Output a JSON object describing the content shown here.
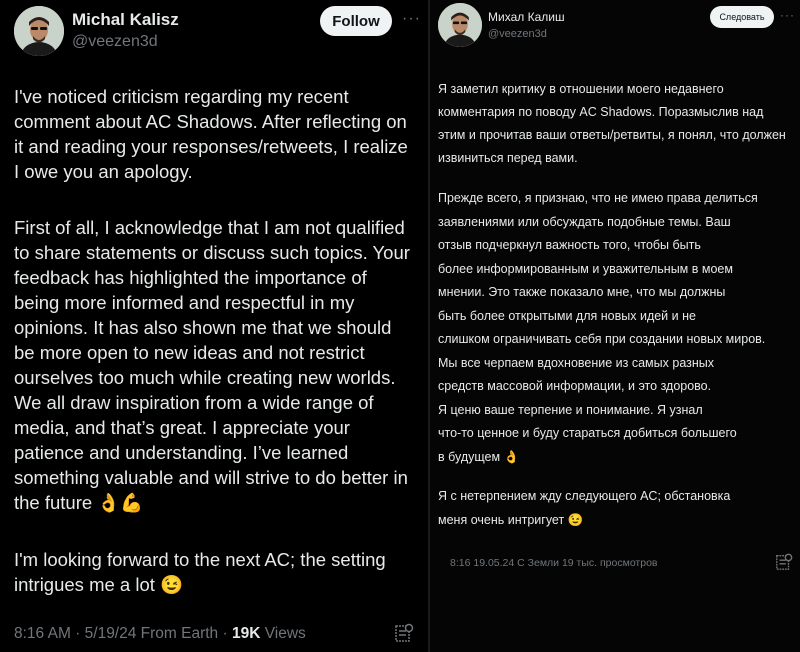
{
  "left": {
    "author_name": "Michal Kalisz",
    "handle": "@veezen3d",
    "follow_label": "Follow",
    "more_label": "···",
    "paragraph1": "I've noticed criticism regarding my recent\ncomment about AC Shadows. After reflecting on\nit and reading your responses/retweets, I realize\nI owe you an apology.",
    "paragraph2": "First of all, I acknowledge that I am not qualified\nto share statements or discuss such topics. Your\nfeedback has highlighted the importance of\nbeing more informed and respectful in my\nopinions. It has also shown me that we should\nbe more open to new ideas and not restrict\nourselves too much while creating new worlds.\nWe all draw inspiration from a wide range of\nmedia, and that’s great. I appreciate your\npatience and understanding. I’ve learned\nsomething valuable and will strive to do better in\nthe future",
    "paragraph2_emoji": "👌💪",
    "paragraph3": "I'm looking forward to the next AC; the setting\nintrigues me a lot",
    "paragraph3_emoji": "😉",
    "meta_time": "8:16 AM · 5/19/24 From Earth · ",
    "meta_views_count": "19K",
    "meta_views_label": " Views"
  },
  "right": {
    "author_name": "Михал Калиш",
    "handle": "@veezen3d",
    "follow_label": "Следовать",
    "more_label": "···",
    "paragraph1": "Я заметил критику в отношении моего недавнего\nкомментария по поводу AC Shadows. Поразмыслив над\nэтим и прочитав ваши ответы/ретвиты, я понял, что должен\nизвиниться перед вами.",
    "paragraph2": "Прежде всего, я признаю, что не имею права делиться\nзаявлениями или обсуждать подобные темы. Ваш\nотзыв подчеркнул важность того, чтобы быть\nболее информированным и уважительным в моем\nмнении. Это также показало мне, что мы должны\nбыть более открытыми для новых идей и не\nслишком ограничивать себя при создании новых миров.\nМы все черпаем вдохновение из самых разных\nсредств массовой информации, и это здорово.\nЯ ценю ваше терпение и понимание. Я узнал\nчто-то ценное и буду стараться добиться большего\nв будущем",
    "paragraph2_emoji": "👌",
    "paragraph3": "Я с нетерпением жду следующего AC; обстановка\nменя очень интригует",
    "paragraph3_emoji": "😉",
    "meta_time": "8:16 19.05.24 С Земли 19 тыс. просмотров"
  },
  "colors": {
    "background": "#000000",
    "text": "#e7e9ea",
    "muted": "#71767b",
    "button_bg": "#eff3f4"
  },
  "icons": {
    "stats": "stats-icon",
    "more": "more-icon"
  }
}
